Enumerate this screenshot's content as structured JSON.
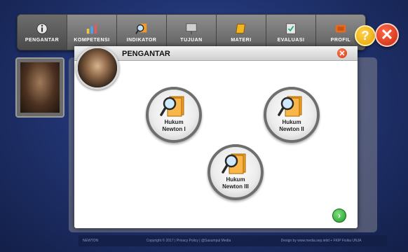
{
  "nav": {
    "items": [
      {
        "label": "PENGANTAR",
        "icon": "info-icon"
      },
      {
        "label": "KOMPETENSI",
        "icon": "chart-icon"
      },
      {
        "label": "INDIKATOR",
        "icon": "magnifier-icon"
      },
      {
        "label": "TUJUAN",
        "icon": "board-icon"
      },
      {
        "label": "MATERI",
        "icon": "book-icon"
      },
      {
        "label": "EVALUASI",
        "icon": "checklist-icon"
      },
      {
        "label": "PROFIL",
        "icon": "profile-icon"
      }
    ]
  },
  "buttons": {
    "help": "?",
    "close": "✕",
    "next": "›",
    "modal_close": "✕"
  },
  "modal": {
    "title": "PENGANTAR",
    "laws": [
      {
        "line1": "Hukum",
        "line2": "Newton I"
      },
      {
        "line1": "Hukum",
        "line2": "Newton II"
      },
      {
        "line1": "Hukum",
        "line2": "Newton III"
      }
    ]
  },
  "footer": {
    "left": "NEWTON",
    "mid": "Copyright © 2017 | Privacy Policy | @Sasumpul Media",
    "right": "Design by www.media.sep.ietid + FKIP Fisika UNJA"
  },
  "colors": {
    "accent": "#e7a200",
    "danger": "#c8260f",
    "success": "#1f9a2a",
    "bg": "#223574"
  }
}
